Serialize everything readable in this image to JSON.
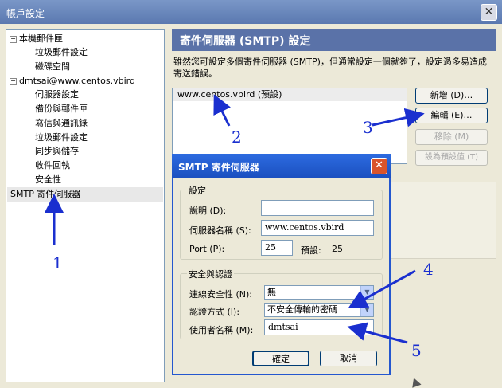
{
  "window": {
    "title": "帳戶設定",
    "close": "✕"
  },
  "tree": {
    "local_folders": "本機郵件匣",
    "local_junk": "垃圾郵件設定",
    "local_disk": "磁碟空間",
    "account": "dmtsai@www.centos.vbird",
    "server_settings": "伺服器設定",
    "copies_folders": "備份與郵件匣",
    "composition": "寫信與通訊錄",
    "junk_settings": "垃圾郵件設定",
    "sync_storage": "同步與儲存",
    "return_receipts": "收件回執",
    "security": "安全性",
    "smtp": "SMTP 寄件伺服器"
  },
  "panel": {
    "title": "寄件伺服器 (SMTP) 設定",
    "description": "雖然您可設定多個寄件伺服器 (SMTP)，但通常設定一個就夠了，設定過多易造成寄送錯誤。",
    "server_entry": "www.centos.vbird (預設)",
    "buttons": {
      "add": "新增 (D)…",
      "edit": "編輯 (E)…",
      "remove": "移除 (M)",
      "set_default": "設為預設值 (T)"
    }
  },
  "dialog": {
    "title": "SMTP 寄件伺服器",
    "close": "✕",
    "settings_legend": "設定",
    "description_label": "說明 (D):",
    "description_value": "",
    "server_label": "伺服器名稱 (S):",
    "server_value": "www.centos.vbird",
    "port_label": "Port (P):",
    "port_value": "25",
    "default_label": "預設:",
    "default_value": "25",
    "security_legend": "安全與認證",
    "conn_security_label": "連線安全性 (N):",
    "conn_security_value": "無",
    "auth_label": "認證方式 (I):",
    "auth_value": "不安全傳輸的密碼",
    "username_label": "使用者名稱 (M):",
    "username_value": "dmtsai",
    "ok": "確定",
    "cancel": "取消"
  },
  "annotations": {
    "n1": "1",
    "n2": "2",
    "n3": "3",
    "n4": "4",
    "n5": "5"
  },
  "colors": {
    "annotation": "#1a2fcf",
    "dialog_title": "#1a4fbf"
  }
}
